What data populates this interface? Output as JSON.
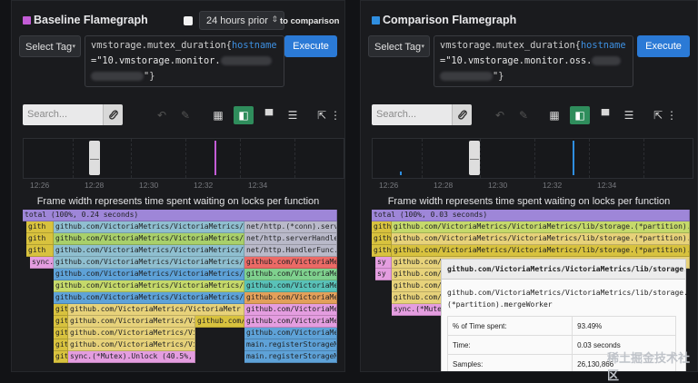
{
  "left": {
    "title": "Baseline Flamegraph",
    "accent": "#c35cd6",
    "time_range": "24 hours prior",
    "comparison_label": "to comparison",
    "tag_button": "Select Tag",
    "query_l1_a": "vmstorage.mutex_duration{",
    "query_l1_b": "hostname",
    "query_l2": "=\"10.vmstorage.monitor.",
    "query_l3": "\"}",
    "execute": "Execute",
    "search_placeholder": "Search...",
    "time_labels": [
      "12:26",
      "12:28",
      "12:30",
      "12:32",
      "12:34"
    ],
    "caption": "Frame width represents time spent waiting on locks per function",
    "frames": {
      "total": "total (100%, 0.24 seconds)",
      "a1": "github.com/VictoriaMetrics/VictoriaMetrics/lib/",
      "a2": "net/http.(*conn).serve",
      "b1": "github.com/VictoriaMetrics/VictoriaMetrics/lib/",
      "b2": "net/http.serverHandler",
      "c1": "github.com/VictoriaMetrics/VictoriaMetrics/lib/",
      "c2": "net/http.HandlerFunc.S",
      "d1": "github.com/VictoriaMetrics/VictoriaMetrics/lib/",
      "d2": "github.com/VictoriaMe",
      "e1": "github.com/VictoriaMetrics/VictoriaMetrics/lib/",
      "e2": "github.com/VictoriaMe",
      "f1": "github.com/VictoriaMetrics/VictoriaMetrics/app/",
      "f2": "github.com/VictoriaMe",
      "g1": "github.com/VictoriaMetrics/VictoriaMetrics/lib/",
      "g2": "github.com/VictoriaMe",
      "h1": "github.com/VictoriaMetrics/VictoriaMetr",
      "h2": "github.com/VictoriaMe",
      "i1": "github.com/VictoriaMetrics/Vict",
      "i2": "github.com/V",
      "i3": "github.com/VictoriaMe",
      "j1": "github.com/VictoriaMetrics/Vict",
      "j2": "github.com/VictoriaMe",
      "k1": "github.com/VictoriaMetrics/Vict",
      "k2": "main.registerStorageMe",
      "l1": "sync.(*Mutex).Unlock (40.5%, 0.",
      "l2": "main.registerStorageMe",
      "sync": "sync.",
      "gith": "gith",
      "gi": "git"
    }
  },
  "right": {
    "title": "Comparison Flamegraph",
    "accent": "#2f8ee0",
    "tag_button": "Select Tag",
    "query_l1_a": "vmstorage.mutex_duration{",
    "query_l1_b": "hostname",
    "query_l2": "=\"10.vmstorage.monitor.oss.",
    "query_l3": "\"}",
    "execute": "Execute",
    "search_placeholder": "Search...",
    "time_labels": [
      "12:26",
      "12:28",
      "12:30",
      "12:32",
      "12:34"
    ],
    "caption": "Frame width represents time spent waiting on locks per function",
    "frames": {
      "total": "total (100%, 0.03 seconds)",
      "a": "github.com/VictoriaMetrics/VictoriaMetrics/lib/storage.(*partition).start",
      "b": "github.com/VictoriaMetrics/VictoriaMetrics/lib/storage.(*partition).merge",
      "c": "github.com/VictoriaMetrics/VictoriaMetrics/lib/storage.(*partition).merge",
      "d": "github.com/VictoriaMetrics/VictoriaMetrics/lib/storage.(*p",
      "e": "github.com/VictoriaMetrics/VictoriaMetr",
      "f": "github.com/VictoriaMetrics/VictoriaMetr",
      "g": "github.com/VictoriaMetrics/VictoriaMetr",
      "h": "sync.(*Mutex).Lock",
      "gith": "gith",
      "gi": "gi",
      "sy": "sy"
    },
    "tooltip": {
      "title": "github.com/VictoriaMetrics/VictoriaMetrics/lib/storage.",
      "full": "github.com/VictoriaMetrics/VictoriaMetrics/lib/storage.(*partition).mergeWorker",
      "rows": [
        {
          "k": "% of Time spent:",
          "v": "93.49%"
        },
        {
          "k": "Time:",
          "v": "0.03 seconds"
        },
        {
          "k": "Samples:",
          "v": "26,130,866"
        }
      ]
    }
  },
  "watermark": "稀土掘金技术社区"
}
